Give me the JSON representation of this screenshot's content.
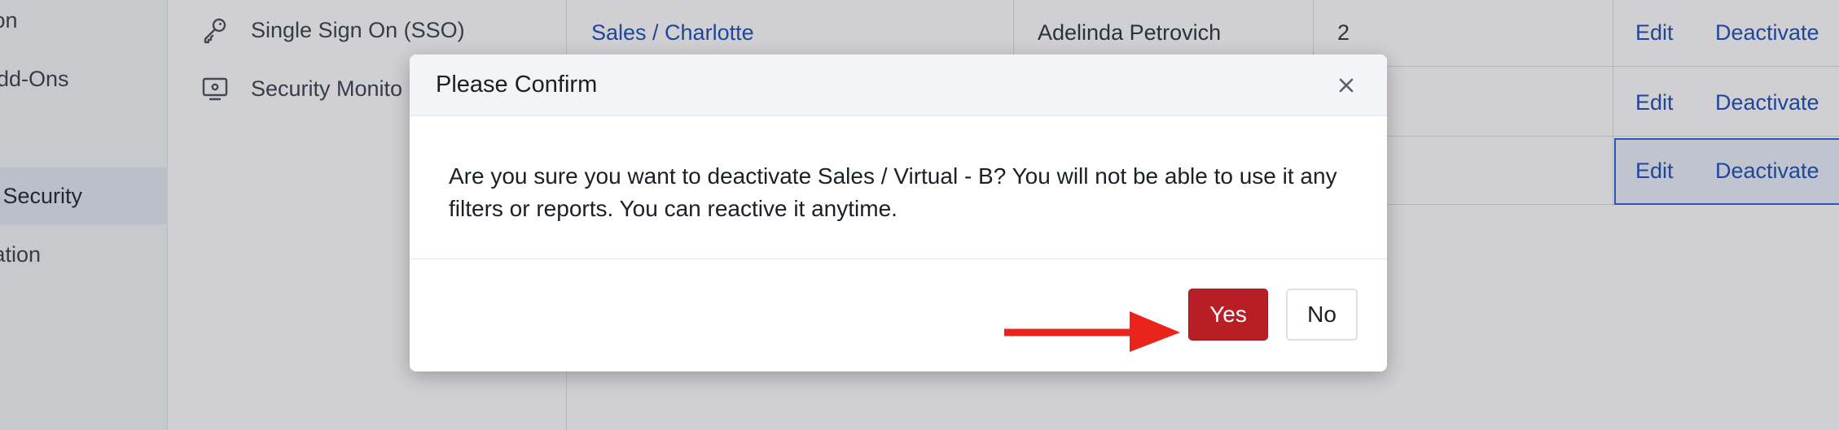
{
  "left_nav": {
    "items": [
      {
        "label": "tion"
      },
      {
        "label": "Add-Ons"
      },
      {
        "label": ""
      },
      {
        "label": "& Security",
        "active": true
      },
      {
        "label": "zation"
      }
    ]
  },
  "sub_nav": {
    "items": [
      {
        "label": "Single Sign On (SSO)",
        "icon": "key-icon"
      },
      {
        "label": "Security Monito",
        "icon": "monitor-icon"
      }
    ]
  },
  "table": {
    "rows": [
      {
        "name": "Sales / Charlotte",
        "owner": "Adelinda Petrovich",
        "count": "2",
        "edit": "Edit",
        "deactivate": "Deactivate"
      },
      {
        "name": "",
        "owner": "",
        "count": "",
        "edit": "Edit",
        "deactivate": "Deactivate"
      },
      {
        "name": "",
        "owner": "",
        "count": "",
        "edit": "Edit",
        "deactivate": "Deactivate",
        "focused": true
      }
    ]
  },
  "modal": {
    "title": "Please Confirm",
    "message": "Are you sure you want to deactivate Sales / Virtual - B? You will not be able to use it any filters or reports. You can reactive it anytime.",
    "yes_label": "Yes",
    "no_label": "No"
  },
  "colors": {
    "primary_danger": "#b81e26",
    "link": "#1d4fb8",
    "arrow": "#e8241c"
  }
}
